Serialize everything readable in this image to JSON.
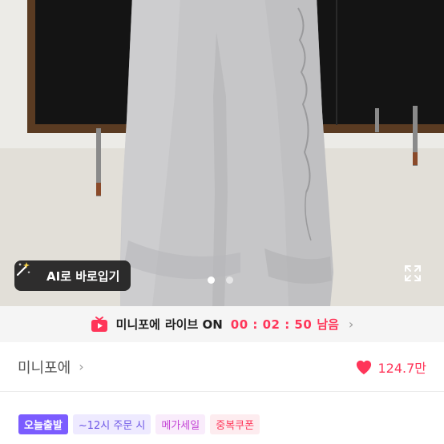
{
  "photo": {
    "ai_try_label": "AI로 바로입기",
    "dots_total": 2,
    "dots_active_index": 0
  },
  "live_banner": {
    "shop": "미니포에",
    "text": "라이브 ON",
    "timer": "00 : 02 : 50",
    "suffix": "남음",
    "accent_color": "#ff3559"
  },
  "shop_row": {
    "shop_name": "미니포에",
    "likes": "124.7만",
    "heart_color": "#ff3559"
  },
  "badges": [
    {
      "label": "오늘출발",
      "kind": "today"
    },
    {
      "label": "~12시 주문 시",
      "kind": "deadline"
    },
    {
      "label": "메가세일",
      "kind": "mega"
    },
    {
      "label": "중복쿠폰",
      "kind": "coupon"
    }
  ],
  "icons": {
    "ai_try": "magic-wand-icon",
    "expand": "expand-icon",
    "live": "live-tv-icon",
    "chevron": "chevron-right-icon",
    "heart": "heart-icon"
  }
}
